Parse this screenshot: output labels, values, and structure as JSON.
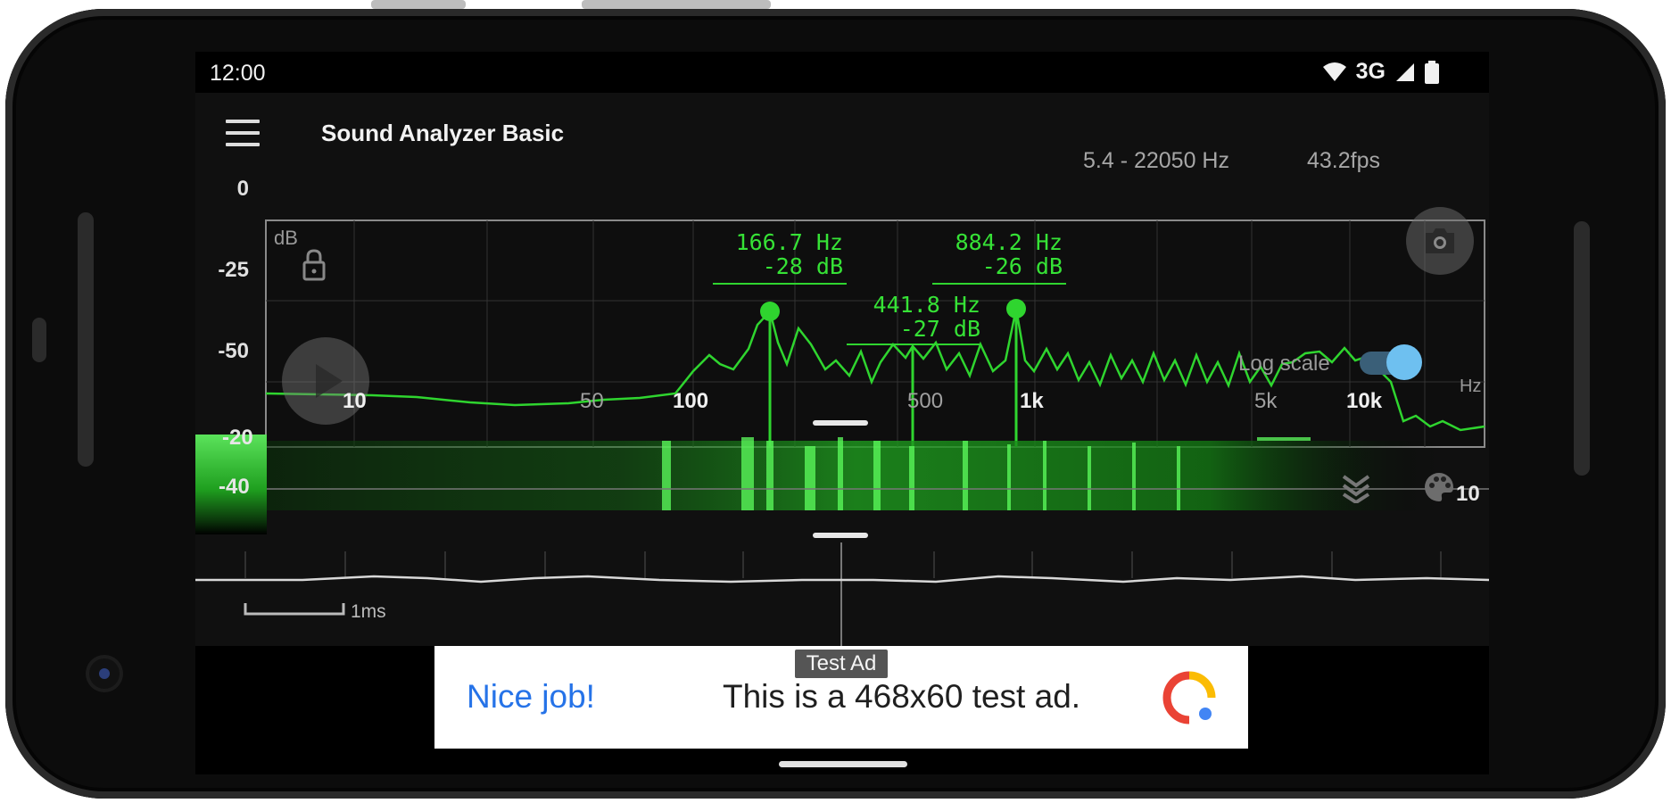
{
  "status_bar": {
    "time": "12:00",
    "network": "3G",
    "icons": [
      "wifi-icon",
      "signal-icon",
      "battery-icon"
    ]
  },
  "toolbar": {
    "title": "Sound Analyzer Basic",
    "menu_icon": "hamburger-menu-icon"
  },
  "spectrum": {
    "range": "5.4 - 22050 Hz",
    "fps": "43.2fps",
    "db_unit": "dB",
    "hz_unit": "Hz",
    "log_scale_label": "Log scale",
    "log_scale_on": true,
    "y_ticks": [
      "0",
      "-25",
      "-50"
    ],
    "x_ticks": [
      {
        "label": "10",
        "bold": true
      },
      {
        "label": "50",
        "bold": false
      },
      {
        "label": "100",
        "bold": true
      },
      {
        "label": "500",
        "bold": false
      },
      {
        "label": "1k",
        "bold": true
      },
      {
        "label": "5k",
        "bold": false
      },
      {
        "label": "10k",
        "bold": true
      }
    ],
    "peaks": [
      {
        "freq": "166.7 Hz",
        "db": "-28 dB"
      },
      {
        "freq": "441.8 Hz",
        "db": "-27 dB"
      },
      {
        "freq": "884.2 Hz",
        "db": "-26 dB"
      }
    ],
    "colors": {
      "trace": "#2fd52f",
      "grid": "#3a3a3a",
      "toggle": "#6ec0f0"
    }
  },
  "spectrogram": {
    "scale_labels": [
      "-20",
      "-40"
    ],
    "right_label": "10",
    "icons": [
      "layers-icon",
      "palette-icon"
    ]
  },
  "waveform": {
    "time_scale": "1ms"
  },
  "ad": {
    "badge": "Test Ad",
    "headline": "Nice job!",
    "body": "This is a 468x60 test ad.",
    "logo": "ad-logo-icon"
  }
}
